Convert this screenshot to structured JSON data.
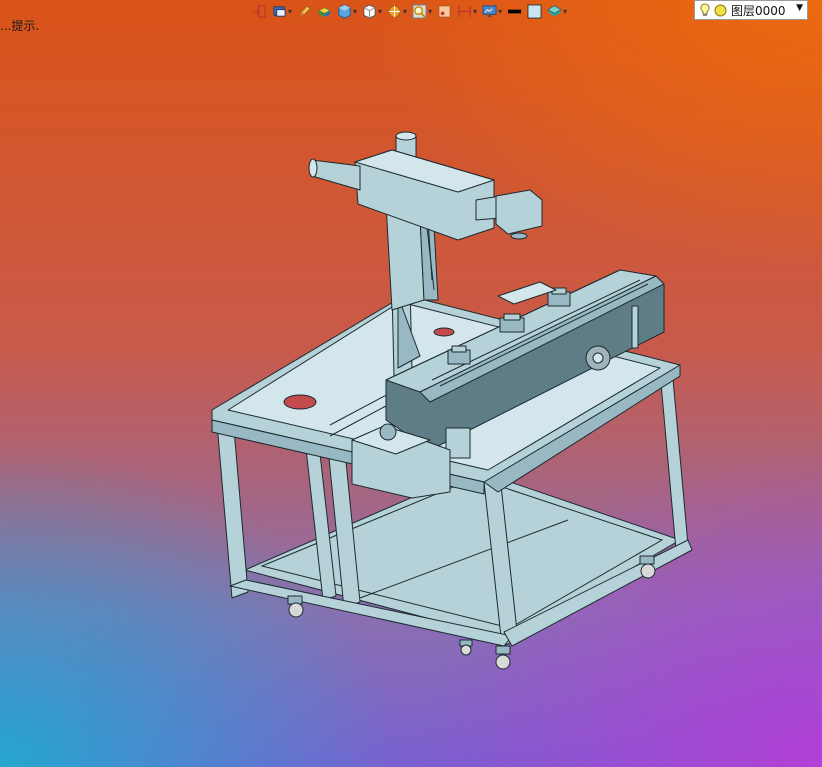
{
  "status_hint": "...提示.",
  "toolbar": {
    "buttons": [
      {
        "icon": "exit-sketch-icon",
        "caret": false
      },
      {
        "icon": "display-mode-icon",
        "caret": true
      },
      {
        "icon": "pencil-icon",
        "caret": false
      },
      {
        "icon": "material-icon",
        "caret": false
      },
      {
        "icon": "view-cube-icon",
        "caret": true
      },
      {
        "icon": "white-box-icon",
        "caret": true
      },
      {
        "icon": "section-icon",
        "caret": true
      },
      {
        "icon": "zoom-icon",
        "caret": true
      },
      {
        "icon": "frame-icon",
        "caret": false
      },
      {
        "icon": "dimension-icon",
        "caret": true
      },
      {
        "icon": "monitor-icon",
        "caret": true
      },
      {
        "icon": "line-style-icon",
        "caret": false
      },
      {
        "icon": "color-swatch-icon",
        "caret": false
      },
      {
        "icon": "layer-stack-icon",
        "caret": true
      }
    ]
  },
  "layer": {
    "label": "图层0000",
    "icons": [
      "bulb-icon",
      "layer-color-icon"
    ]
  },
  "colors": {
    "steel": "#b7d3da",
    "steel_dark": "#6f8a93",
    "edge": "#1b2a30",
    "red": "#c34b4b"
  }
}
